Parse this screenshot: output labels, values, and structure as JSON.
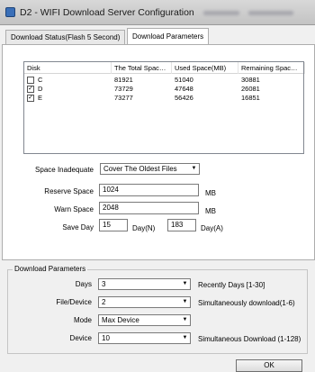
{
  "window": {
    "title": "D2 - WIFI Download Server Configuration"
  },
  "tabs": [
    {
      "label": "Download Status(Flash 5 Second)"
    },
    {
      "label": "Download Parameters"
    }
  ],
  "disk_table": {
    "headers": [
      "Disk",
      "The Total Spac…",
      "Used Space(MB)",
      "Remaining Spac…"
    ],
    "rows": [
      {
        "disk": "C",
        "checked": false,
        "total": "81921",
        "used": "51040",
        "remaining": "30881"
      },
      {
        "disk": "D",
        "checked": true,
        "total": "73729",
        "used": "47648",
        "remaining": "26081"
      },
      {
        "disk": "E",
        "checked": true,
        "total": "73277",
        "used": "56426",
        "remaining": "16851"
      }
    ]
  },
  "space": {
    "inadequate_label": "Space Inadequate",
    "inadequate_value": "Cover The Oldest Files",
    "reserve_label": "Reserve Space",
    "reserve_value": "1024",
    "reserve_unit": "MB",
    "warn_label": "Warn Space",
    "warn_value": "2048",
    "warn_unit": "MB",
    "saveday_label": "Save Day",
    "saveday_n_value": "15",
    "saveday_n_unit": "Day(N)",
    "saveday_a_value": "183",
    "saveday_a_unit": "Day(A)"
  },
  "download_params": {
    "title": "Download Parameters",
    "days_label": "Days",
    "days_value": "3",
    "days_hint": "Recently Days [1-30]",
    "filedevice_label": "File/Device",
    "filedevice_value": "2",
    "filedevice_hint": "Simultaneously download(1-6)",
    "mode_label": "Mode",
    "mode_value": "Max Device",
    "device_label": "Device",
    "device_value": "10",
    "device_hint": "Simultaneous Download (1-128)"
  },
  "buttons": {
    "ok": "OK"
  }
}
